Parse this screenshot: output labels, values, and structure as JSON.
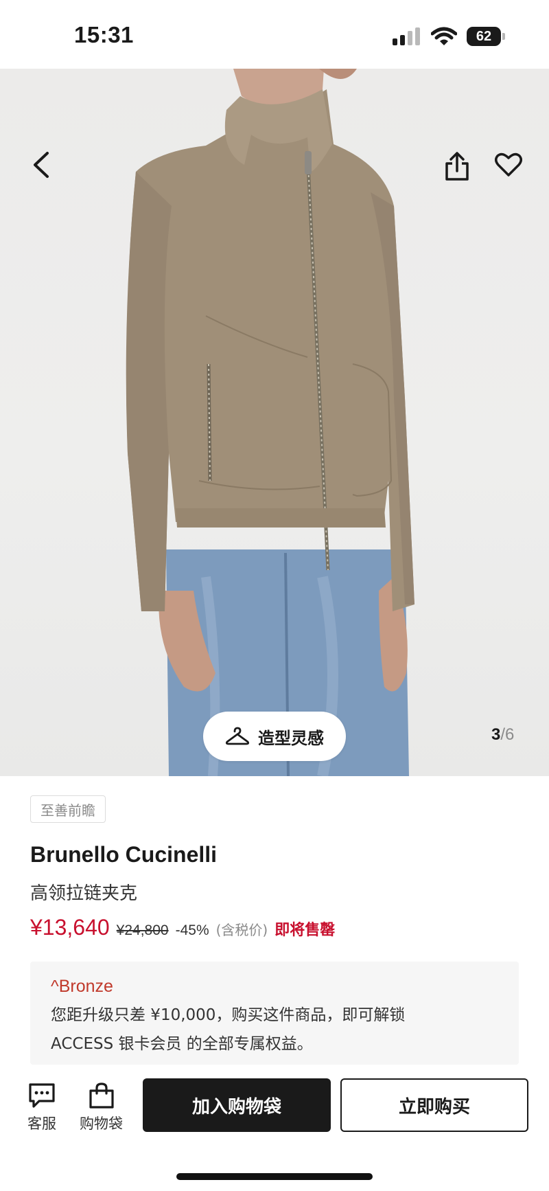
{
  "status_bar": {
    "time": "15:31",
    "battery_level": "62",
    "icons": [
      "signal-icon",
      "wifi-icon",
      "battery-icon"
    ]
  },
  "nav": {
    "back_icon": "chevron-left-icon",
    "share_icon": "share-icon",
    "favorite_icon": "heart-icon"
  },
  "gallery": {
    "current_page": "3",
    "separator": "/",
    "total_pages": "6",
    "style_button_label": "造型灵感",
    "style_button_icon": "hanger-icon"
  },
  "product": {
    "tag": "至善前瞻",
    "brand": "Brunello Cucinelli",
    "name": "高领拉链夹克",
    "price": {
      "sale": "¥13,640",
      "original": "¥24,800",
      "discount": "-45%",
      "tax_note": "(含税价)",
      "status": "即将售罄"
    }
  },
  "membership": {
    "tier": "^Bronze",
    "line1": "您距升级只差 ¥10,000，购买这件商品，即可解锁",
    "line2": "ACCESS 银卡会员 的全部专属权益。"
  },
  "bottom_bar": {
    "service_label": "客服",
    "service_icon": "chat-bubble-icon",
    "bag_label": "购物袋",
    "bag_icon": "shopping-bag-icon",
    "add_to_bag_label": "加入购物袋",
    "buy_now_label": "立即购买"
  },
  "colors": {
    "accent_red": "#c8102e",
    "primary_dark": "#1a1a1a",
    "card_bg": "#f6f6f6"
  }
}
